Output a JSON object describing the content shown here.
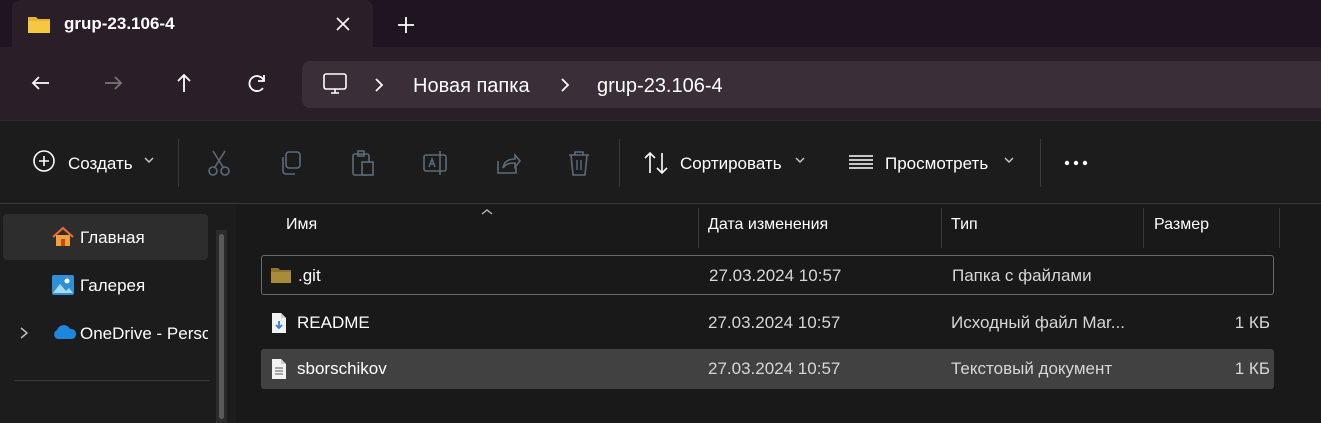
{
  "tab": {
    "title": "grup-23.106-4"
  },
  "address": {
    "crumbs": [
      "Новая папка",
      "grup-23.106-4"
    ]
  },
  "toolbar": {
    "create_label": "Создать",
    "sort_label": "Сортировать",
    "view_label": "Просмотреть"
  },
  "sidebar": {
    "items": [
      {
        "label": "Главная",
        "icon": "home-icon"
      },
      {
        "label": "Галерея",
        "icon": "gallery-icon"
      },
      {
        "label": "OneDrive - Personal",
        "icon": "onedrive-icon"
      }
    ]
  },
  "columns": {
    "name": "Имя",
    "date": "Дата изменения",
    "type": "Тип",
    "size": "Размер"
  },
  "files": [
    {
      "name": ".git",
      "date": "27.03.2024 10:57",
      "type": "Папка с файлами",
      "size": ""
    },
    {
      "name": "README",
      "date": "27.03.2024 10:57",
      "type": "Исходный файл Mar...",
      "size": "1 КБ"
    },
    {
      "name": "sborschikov",
      "date": "27.03.2024 10:57",
      "type": "Текстовый документ",
      "size": "1 КБ"
    }
  ],
  "colors": {
    "accent_folder": "#d9a520",
    "selected_row": "#414141",
    "title_bg": "#1f1520"
  }
}
